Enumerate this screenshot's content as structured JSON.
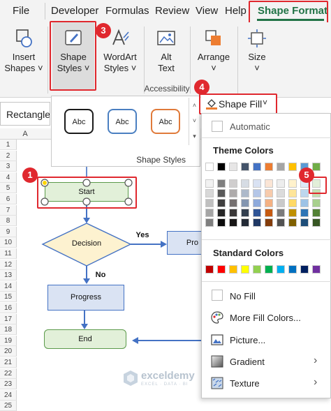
{
  "tabs": [
    "File",
    "Developer",
    "Formulas",
    "Review",
    "View",
    "Help",
    "Shape Format"
  ],
  "ribbon": {
    "insert_shapes": [
      "Insert",
      "Shapes"
    ],
    "shape_styles": [
      "Shape",
      "Styles"
    ],
    "wordart_styles": [
      "WordArt",
      "Styles"
    ],
    "alt_text": [
      "Alt",
      "Text"
    ],
    "accessibility_label": "Accessibility",
    "arrange": "Arrange",
    "size": "Size"
  },
  "name_box": "Rectangle",
  "column_a": "A",
  "rows": [
    "1",
    "2",
    "3",
    "4",
    "5",
    "6",
    "7",
    "8",
    "9",
    "10",
    "11",
    "12",
    "13",
    "14",
    "15",
    "16",
    "17",
    "18",
    "19",
    "20",
    "21",
    "22",
    "23",
    "24",
    "25"
  ],
  "gallery": {
    "swatch_label": "Abc",
    "caption": "Shape Styles",
    "swatch_colors": [
      "#1b1b1b",
      "#4a7fc1",
      "#e07a3a"
    ]
  },
  "shape_fill": {
    "label": "Shape Fill",
    "automatic": "Automatic",
    "theme_colors": "Theme Colors",
    "standard_colors": "Standard Colors",
    "no_fill": "No Fill",
    "more_colors": "More Fill Colors...",
    "picture": "Picture...",
    "gradient": "Gradient",
    "texture": "Texture",
    "theme_top": [
      "#ffffff",
      "#000000",
      "#e7e6e6",
      "#44546a",
      "#4472c4",
      "#ed7d31",
      "#a5a5a5",
      "#ffc000",
      "#5b9bd5",
      "#70ad47"
    ],
    "theme_shades": [
      [
        "#f2f2f2",
        "#7f7f7f",
        "#d0cece",
        "#d6dce4",
        "#d9e2f3",
        "#fbe5d5",
        "#ededed",
        "#fff2cc",
        "#deebf6",
        "#e2efd9"
      ],
      [
        "#d8d8d8",
        "#595959",
        "#aeabab",
        "#adb9ca",
        "#b4c6e7",
        "#f7cbac",
        "#dbdbdb",
        "#fee599",
        "#bdd7ee",
        "#c5e0b3"
      ],
      [
        "#bfbfbf",
        "#3f3f3f",
        "#757070",
        "#8496b0",
        "#8eaadb",
        "#f4b183",
        "#c9c9c9",
        "#ffd965",
        "#9dc3e6",
        "#a8d08d"
      ],
      [
        "#a5a5a5",
        "#262626",
        "#3a3838",
        "#323f4f",
        "#2f5496",
        "#c55a11",
        "#7b7b7b",
        "#bf9000",
        "#2e75b5",
        "#538135"
      ],
      [
        "#7f7f7f",
        "#0c0c0c",
        "#171616",
        "#222a35",
        "#1f3864",
        "#833c0b",
        "#525252",
        "#7f6000",
        "#1e4e79",
        "#375623"
      ]
    ],
    "standard": [
      "#c00000",
      "#ff0000",
      "#ffc000",
      "#ffff00",
      "#92d050",
      "#00b050",
      "#00b0f0",
      "#0070c0",
      "#002060",
      "#7030a0"
    ]
  },
  "flowchart": {
    "start": "Start",
    "decision": "Decision",
    "progress": "Progress",
    "end": "End",
    "yes": "Yes",
    "no": "No",
    "pro_partial": "Pro"
  },
  "badges": [
    "1",
    "2",
    "3",
    "4",
    "5"
  ],
  "watermark": {
    "name": "exceldemy",
    "tagline": "EXCEL · DATA · BI"
  },
  "colors": {
    "accent_green": "#217346",
    "callout_red": "#e0282e",
    "start_fill": "#e2f0d9",
    "decision_fill": "#fdf2d0",
    "progress_fill": "#dae3f3"
  }
}
